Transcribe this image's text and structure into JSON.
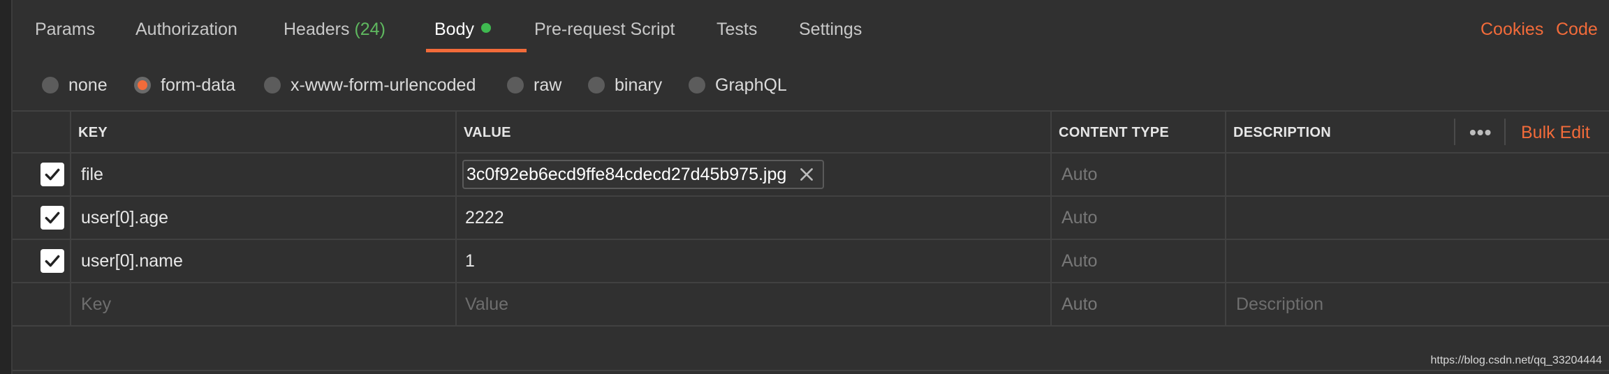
{
  "tabs": [
    {
      "label": "Params"
    },
    {
      "label": "Authorization"
    },
    {
      "label": "Headers",
      "count": "(24)"
    },
    {
      "label": "Body",
      "active": true
    },
    {
      "label": "Pre-request Script"
    },
    {
      "label": "Tests"
    },
    {
      "label": "Settings"
    }
  ],
  "top_links": {
    "cookies": "Cookies",
    "code": "Code"
  },
  "body_types": [
    {
      "label": "none",
      "selected": false
    },
    {
      "label": "form-data",
      "selected": true
    },
    {
      "label": "x-www-form-urlencoded",
      "selected": false
    },
    {
      "label": "raw",
      "selected": false
    },
    {
      "label": "binary",
      "selected": false
    },
    {
      "label": "GraphQL",
      "selected": false
    }
  ],
  "table": {
    "headers": {
      "key": "KEY",
      "value": "VALUE",
      "content_type": "CONTENT TYPE",
      "description": "DESCRIPTION"
    },
    "bulk_edit": "Bulk Edit",
    "rows": [
      {
        "checked": true,
        "key": "file",
        "value": "3c0f92eb6ecd9ffe84cdecd27d45b975.jpg",
        "content_type": "Auto",
        "description": ""
      },
      {
        "checked": true,
        "key": "user[0].age",
        "value": "2222",
        "content_type": "Auto",
        "description": ""
      },
      {
        "checked": true,
        "key": "user[0].name",
        "value": "1",
        "content_type": "Auto",
        "description": ""
      }
    ],
    "new_row": {
      "key": "Key",
      "value": "Value",
      "content_type": "Auto",
      "description": "Description"
    }
  },
  "colors": {
    "accent": "#f26b3a",
    "active_dot": "#3fb950",
    "count_green": "#5fb85f",
    "background": "#303030"
  },
  "watermark": "https://blog.csdn.net/qq_33204444"
}
